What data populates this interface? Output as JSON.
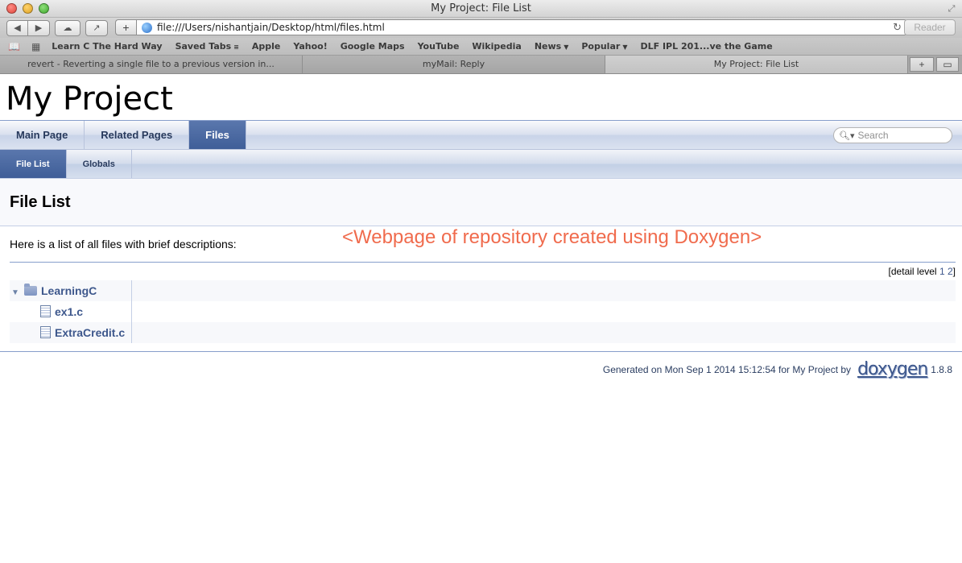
{
  "window": {
    "title": "My Project: File List"
  },
  "toolbar": {
    "url": "file:///Users/nishantjain/Desktop/html/files.html",
    "reader_label": "Reader"
  },
  "bookmarks": [
    {
      "label": "Learn C The Hard Way"
    },
    {
      "label": "Saved Tabs"
    },
    {
      "label": "Apple"
    },
    {
      "label": "Yahoo!"
    },
    {
      "label": "Google Maps"
    },
    {
      "label": "YouTube"
    },
    {
      "label": "Wikipedia"
    },
    {
      "label": "News"
    },
    {
      "label": "Popular"
    },
    {
      "label": "DLF IPL 201...ve the Game"
    }
  ],
  "tabs": [
    {
      "label": "revert - Reverting a single file to a previous version in..."
    },
    {
      "label": "myMail: Reply"
    },
    {
      "label": "My Project: File List"
    }
  ],
  "page": {
    "project_title": "My Project",
    "nav_main": [
      "Main Page",
      "Related Pages",
      "Files"
    ],
    "nav_sub": [
      "File List",
      "Globals"
    ],
    "search_placeholder": "Search",
    "heading": "File List",
    "intro": "Here is a list of all files with brief descriptions:",
    "annotation": "<Webpage of repository created using Doxygen>",
    "detail_level_label": "[detail level",
    "detail_levels": [
      "1",
      "2"
    ],
    "detail_close": "]",
    "tree": {
      "folder": "LearningC",
      "files": [
        "ex1.c",
        "ExtraCredit.c"
      ]
    },
    "footer": {
      "generated": "Generated on Mon Sep 1 2014 15:12:54 for My Project by",
      "logo": "doxygen",
      "version": "1.8.8"
    }
  }
}
